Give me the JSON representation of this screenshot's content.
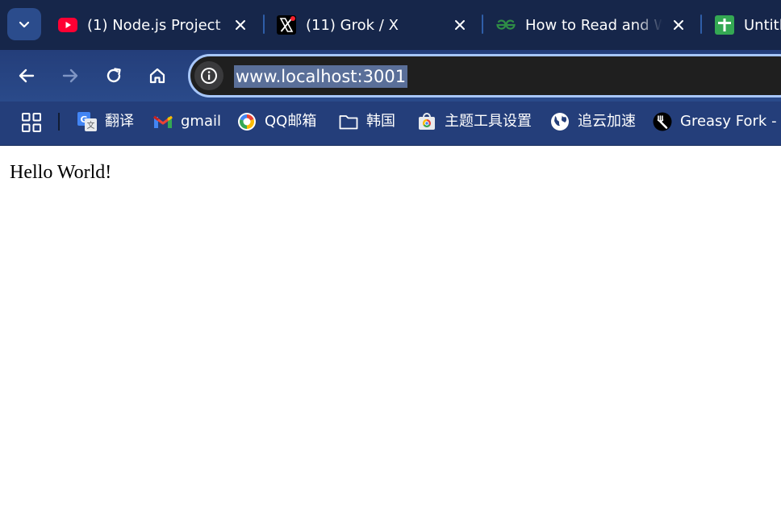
{
  "tabs": [
    {
      "title": "(1) Node.js Project",
      "favicon": "youtube-icon"
    },
    {
      "title": "(11) Grok / X",
      "favicon": "x-logo-icon"
    },
    {
      "title": "How to Read and W",
      "favicon": "geeksforgeeks-icon"
    },
    {
      "title": "Untitl",
      "favicon": "google-sheets-icon"
    }
  ],
  "address_bar": {
    "url": "www.localhost:3001"
  },
  "bookmarks": [
    {
      "label": "翻译",
      "icon": "google-translate-icon"
    },
    {
      "label": "gmail",
      "icon": "gmail-icon"
    },
    {
      "label": "QQ邮箱",
      "icon": "qq-mail-icon"
    },
    {
      "label": "韩国",
      "icon": "folder-icon"
    },
    {
      "label": "主题工具设置",
      "icon": "chrome-web-store-icon"
    },
    {
      "label": "追云加速",
      "icon": "globe-icon"
    },
    {
      "label": "Greasy Fork - 安",
      "icon": "greasy-fork-icon"
    }
  ],
  "page": {
    "text": "Hello World!"
  },
  "colors": {
    "tab_strip": "#16264a",
    "toolbar": "#2a4a8a",
    "omnibox_border": "#a8c7fa",
    "omnibox_bg": "#1f1f1f",
    "url_selection": "#5a6f99"
  }
}
